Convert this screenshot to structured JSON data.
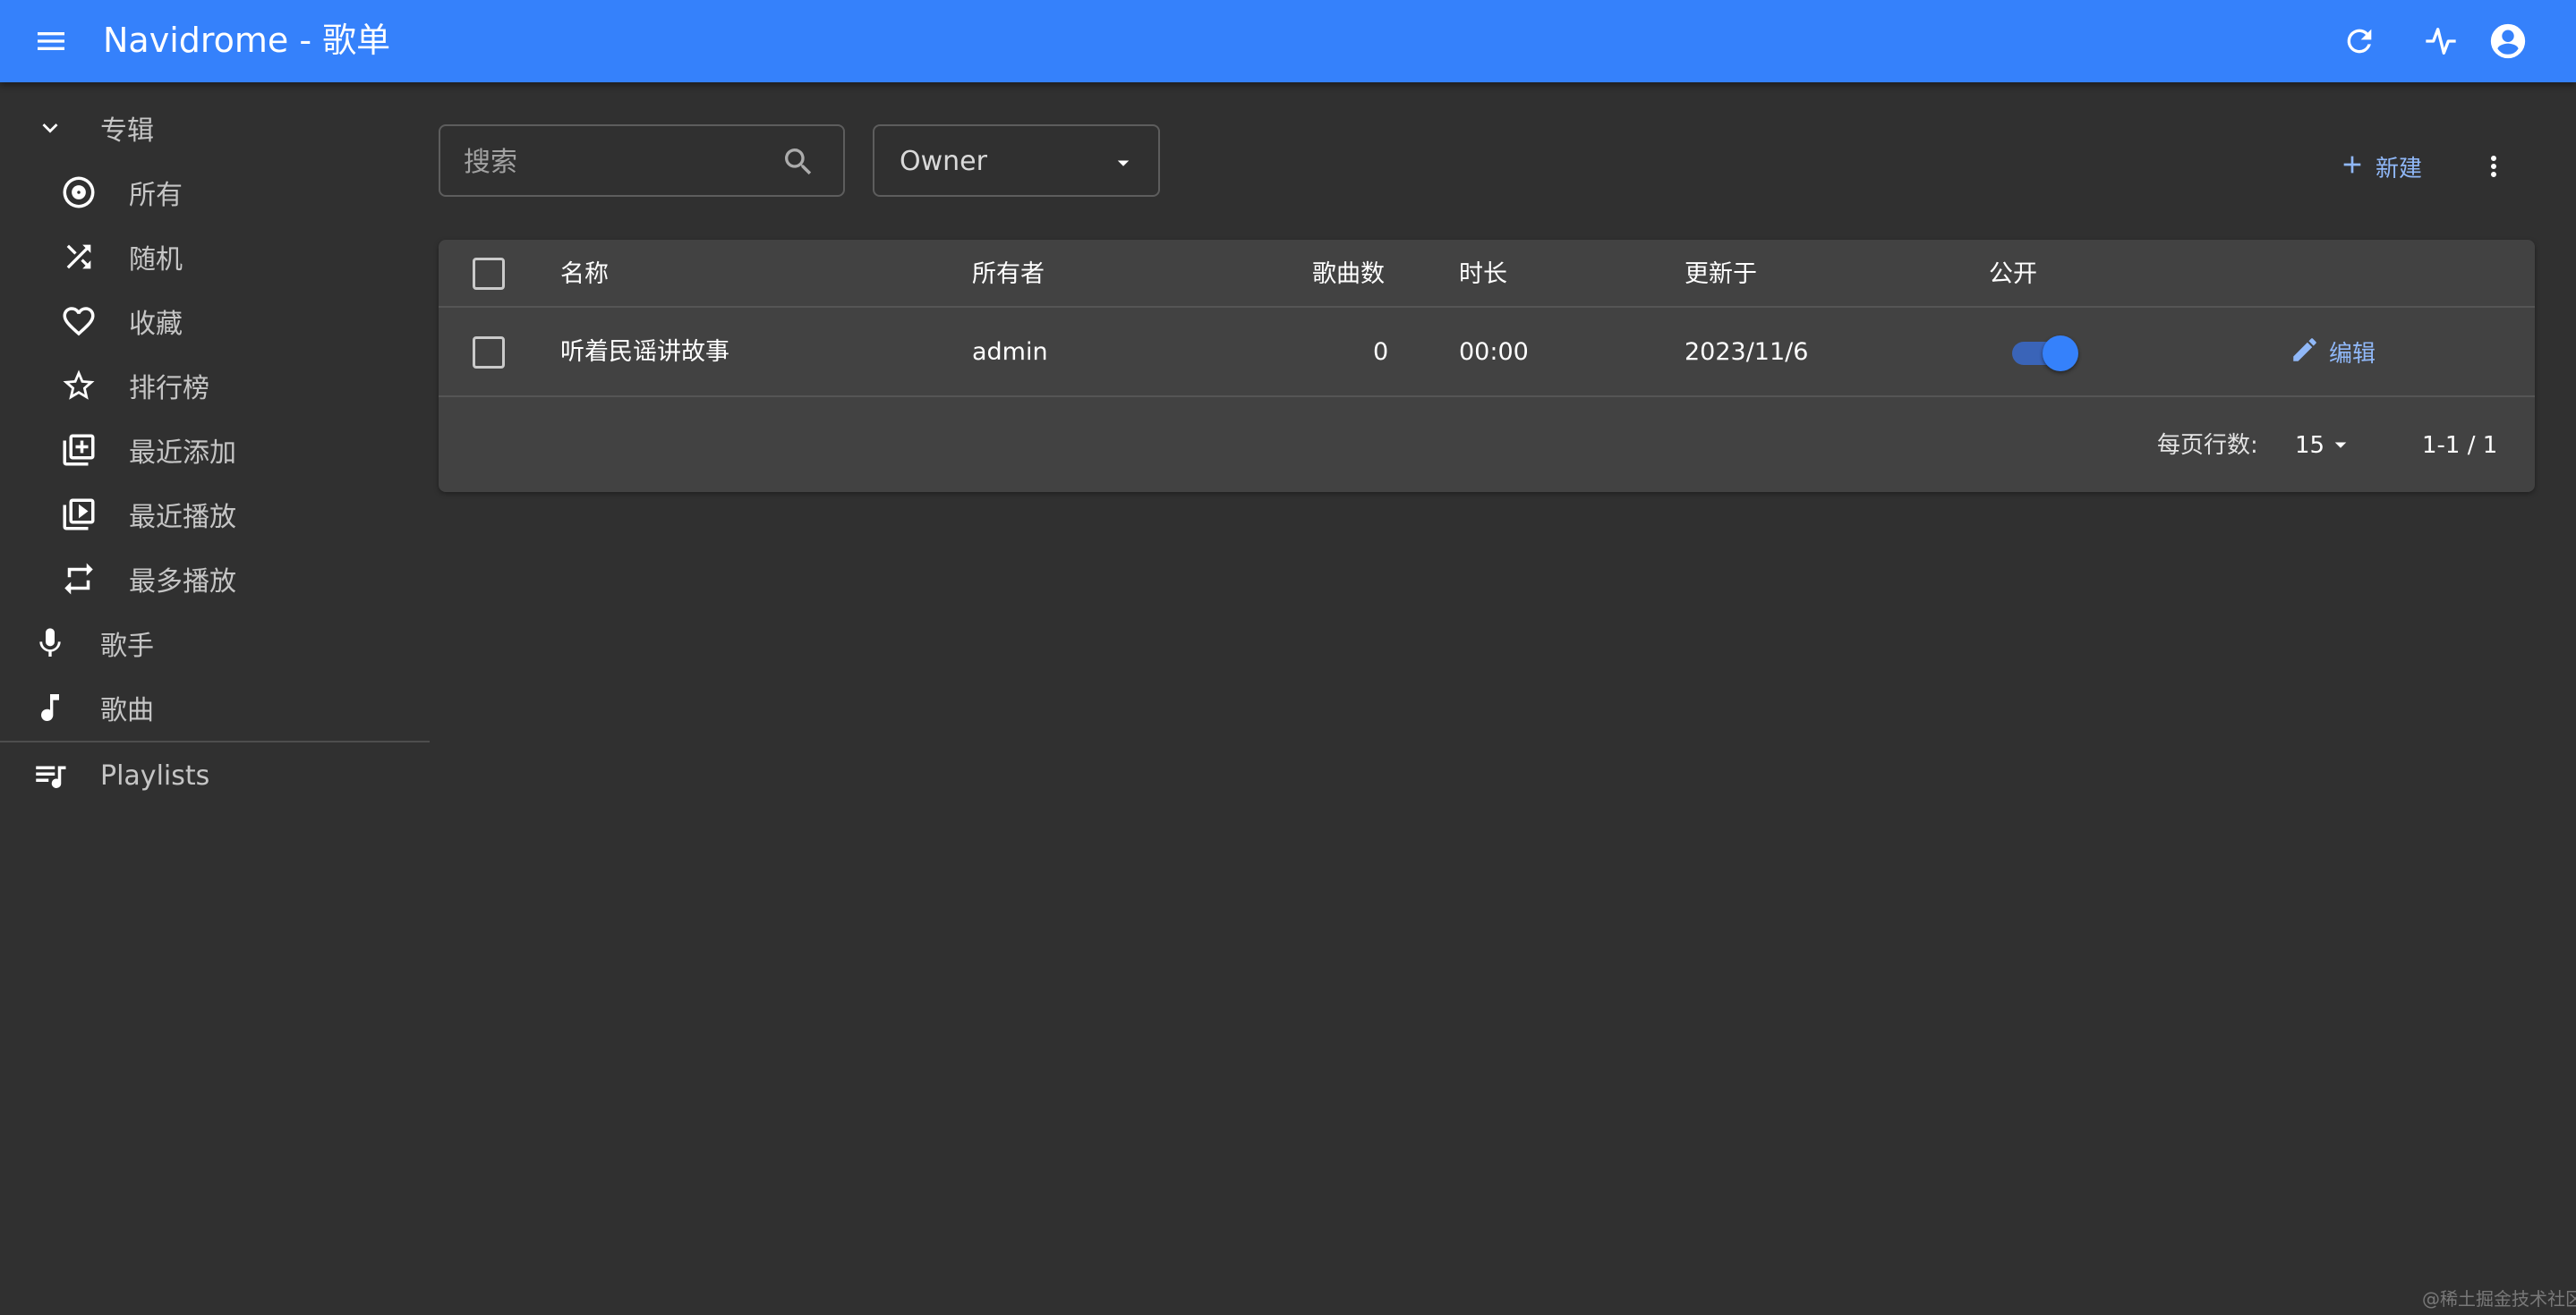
{
  "app": {
    "title": "Navidrome - 歌单"
  },
  "appbar": {
    "menu_icon": "menu-icon",
    "refresh_icon": "refresh-icon",
    "activity_icon": "activity-icon",
    "account_icon": "account-circle-icon"
  },
  "sidebar": {
    "albums_group": {
      "label": "专辑",
      "expanded": true
    },
    "album_items": [
      {
        "label": "所有",
        "icon": "album-disc-icon"
      },
      {
        "label": "随机",
        "icon": "shuffle-icon"
      },
      {
        "label": "收藏",
        "icon": "heart-icon"
      },
      {
        "label": "排行榜",
        "icon": "star-icon"
      },
      {
        "label": "最近添加",
        "icon": "library-add-icon"
      },
      {
        "label": "最近播放",
        "icon": "library-play-icon"
      },
      {
        "label": "最多播放",
        "icon": "repeat-icon"
      }
    ],
    "artists": {
      "label": "歌手",
      "icon": "microphone-icon"
    },
    "songs": {
      "label": "歌曲",
      "icon": "music-note-icon"
    },
    "playlists": {
      "label": "Playlists",
      "icon": "playlist-icon"
    }
  },
  "filters": {
    "search_placeholder": "搜索",
    "owner_value": "Owner"
  },
  "actions": {
    "create_label": "新建"
  },
  "table": {
    "columns": [
      "名称",
      "所有者",
      "歌曲数",
      "时长",
      "更新于",
      "公开"
    ],
    "rows": [
      {
        "name": "听着民谣讲故事",
        "owner": "admin",
        "songs": "0",
        "duration": "00:00",
        "updated": "2023/11/6",
        "public": true,
        "edit_label": "编辑"
      }
    ]
  },
  "pagination": {
    "rows_per_page_label": "每页行数:",
    "rows_per_page": "15",
    "range": "1-1 / 1"
  },
  "colors": {
    "primary": "#3581fb",
    "background": "#303030",
    "card": "#424242",
    "link": "#90b8f8"
  },
  "watermark": "@稀土掘金技术社区"
}
